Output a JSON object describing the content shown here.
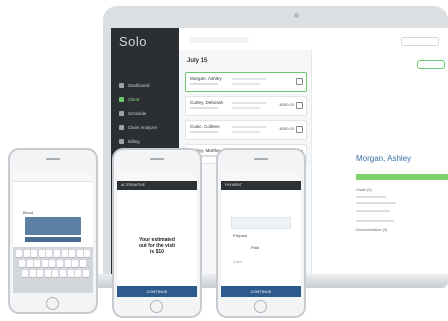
{
  "app": {
    "brand": "Solo",
    "brand_sub": "",
    "search_placeholder": "",
    "date_header": "July 15",
    "filter_label": ""
  },
  "nav": [
    {
      "label": "Dashboard",
      "active": false
    },
    {
      "label": "Client",
      "active": true
    },
    {
      "label": "Schedule",
      "active": false
    },
    {
      "label": "Claim Analyzer",
      "active": false
    },
    {
      "label": "Billing",
      "active": false
    },
    {
      "label": "Analytics",
      "active": false
    }
  ],
  "appointments": [
    {
      "name": "Morgan, Ashley",
      "amount": "",
      "selected": true
    },
    {
      "name": "Curley, Deborah",
      "amount": "$000.00",
      "selected": false
    },
    {
      "name": "Cusic, Colleen",
      "amount": "$000.00",
      "selected": false
    },
    {
      "name": "Curley, Martha",
      "amount": "$000.00",
      "selected": false
    }
  ],
  "detail": {
    "name": "Morgan, Ashley",
    "action_label": "",
    "sections": [
      "Goals (3)",
      "Documentation (3)"
    ]
  },
  "phone_left": {
    "field_value": "Blood",
    "suggestions": [
      "",
      "",
      ""
    ]
  },
  "phone_mid": {
    "header": "ALTERNATIVE",
    "message_lines": [
      "Your estimated",
      "out for the visit",
      "is $10"
    ],
    "footer": "CONTINUE"
  },
  "phone_right": {
    "header": "PAYMENT",
    "options": [
      "Prepaid",
      "Paid",
      "Card"
    ],
    "footer": "CONTINUE"
  },
  "colors": {
    "accent": "#6cc76a",
    "primary": "#2c5a8c",
    "sidebar": "#2b2f33",
    "link": "#3a6ea8"
  },
  "icons": [
    "dashboard-icon",
    "client-icon",
    "schedule-icon",
    "claim-icon",
    "billing-icon",
    "analytics-icon",
    "calendar-icon",
    "search-icon"
  ]
}
